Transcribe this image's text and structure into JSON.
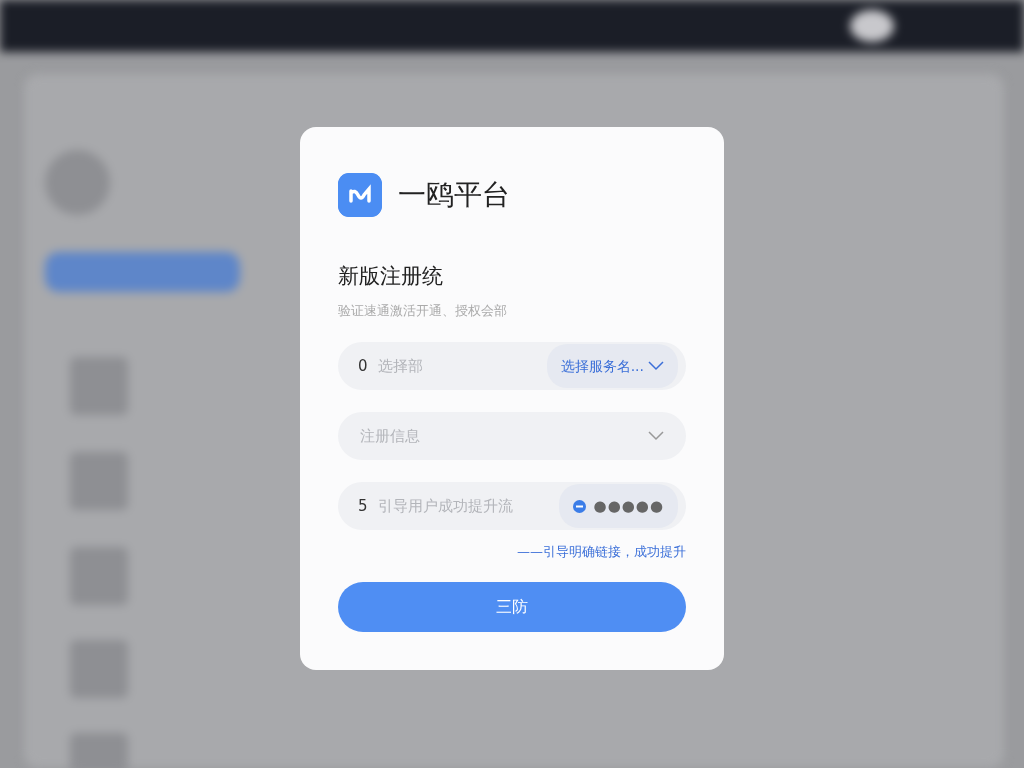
{
  "dialog": {
    "brand": "一鸥平台",
    "title": "新版注册统",
    "subtitle": "验证速通激活开通、授权会部",
    "fields": [
      {
        "kind": "select-pill",
        "prefix": "0",
        "placeholder": "选择部",
        "pill": "选择服务名..."
      },
      {
        "kind": "select",
        "placeholder": "注册信息"
      },
      {
        "kind": "code",
        "prefix": "5",
        "placeholder": "引导用户成功提升流",
        "masked": "●●●●●"
      }
    ],
    "link": "——引导明确链接，成功提升",
    "submit": "三防"
  }
}
